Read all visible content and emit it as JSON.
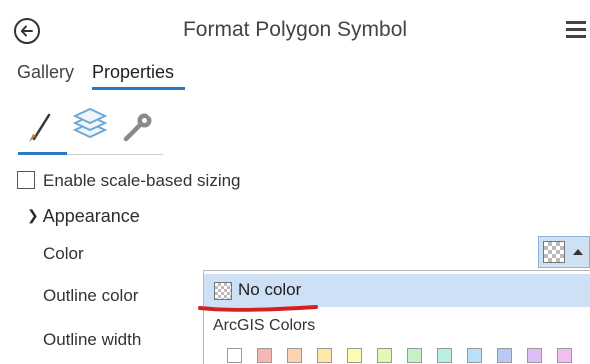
{
  "header": {
    "title": "Format Polygon Symbol",
    "back_icon": "back-arrow-icon",
    "menu_icon": "hamburger-menu-icon"
  },
  "tabs": [
    {
      "label": "Gallery",
      "selected": false
    },
    {
      "label": "Properties",
      "selected": true
    }
  ],
  "icon_tabs": [
    {
      "icon": "brush-icon",
      "selected": true
    },
    {
      "icon": "layers-icon",
      "selected": false
    },
    {
      "icon": "wrench-icon",
      "selected": false
    }
  ],
  "scale_sizing": {
    "label": "Enable scale-based sizing",
    "checked": false
  },
  "appearance": {
    "label": "Appearance",
    "expanded": true
  },
  "properties": [
    {
      "label": "Color"
    },
    {
      "label": "Outline color"
    },
    {
      "label": "Outline width"
    }
  ],
  "color_picker": {
    "current": "no-color",
    "dropdown": {
      "no_color_label": "No color",
      "section_label": "ArcGIS Colors",
      "swatch_colors": [
        "#ffffff",
        "#f7b6b6",
        "#fbd3b0",
        "#fde8a8",
        "#fdfbb0",
        "#e2f8b4",
        "#c4f2c4",
        "#b8f0e4",
        "#b9e0f7",
        "#bcc9f6",
        "#dcc0f5",
        "#f4bdf0"
      ]
    }
  },
  "annotation": {
    "color": "#d62020"
  },
  "colors": {
    "accent": "#2b79c2",
    "selection": "#cde0f5"
  }
}
